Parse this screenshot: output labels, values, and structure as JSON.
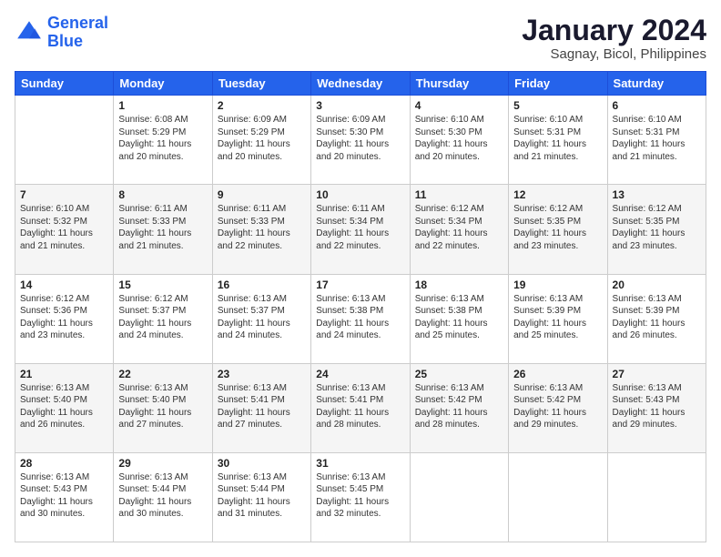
{
  "logo": {
    "line1": "General",
    "line2": "Blue"
  },
  "title": "January 2024",
  "subtitle": "Sagnay, Bicol, Philippines",
  "days_header": [
    "Sunday",
    "Monday",
    "Tuesday",
    "Wednesday",
    "Thursday",
    "Friday",
    "Saturday"
  ],
  "weeks": [
    [
      {
        "num": "",
        "detail": ""
      },
      {
        "num": "1",
        "detail": "Sunrise: 6:08 AM\nSunset: 5:29 PM\nDaylight: 11 hours\nand 20 minutes."
      },
      {
        "num": "2",
        "detail": "Sunrise: 6:09 AM\nSunset: 5:29 PM\nDaylight: 11 hours\nand 20 minutes."
      },
      {
        "num": "3",
        "detail": "Sunrise: 6:09 AM\nSunset: 5:30 PM\nDaylight: 11 hours\nand 20 minutes."
      },
      {
        "num": "4",
        "detail": "Sunrise: 6:10 AM\nSunset: 5:30 PM\nDaylight: 11 hours\nand 20 minutes."
      },
      {
        "num": "5",
        "detail": "Sunrise: 6:10 AM\nSunset: 5:31 PM\nDaylight: 11 hours\nand 21 minutes."
      },
      {
        "num": "6",
        "detail": "Sunrise: 6:10 AM\nSunset: 5:31 PM\nDaylight: 11 hours\nand 21 minutes."
      }
    ],
    [
      {
        "num": "7",
        "detail": "Sunrise: 6:10 AM\nSunset: 5:32 PM\nDaylight: 11 hours\nand 21 minutes."
      },
      {
        "num": "8",
        "detail": "Sunrise: 6:11 AM\nSunset: 5:33 PM\nDaylight: 11 hours\nand 21 minutes."
      },
      {
        "num": "9",
        "detail": "Sunrise: 6:11 AM\nSunset: 5:33 PM\nDaylight: 11 hours\nand 22 minutes."
      },
      {
        "num": "10",
        "detail": "Sunrise: 6:11 AM\nSunset: 5:34 PM\nDaylight: 11 hours\nand 22 minutes."
      },
      {
        "num": "11",
        "detail": "Sunrise: 6:12 AM\nSunset: 5:34 PM\nDaylight: 11 hours\nand 22 minutes."
      },
      {
        "num": "12",
        "detail": "Sunrise: 6:12 AM\nSunset: 5:35 PM\nDaylight: 11 hours\nand 23 minutes."
      },
      {
        "num": "13",
        "detail": "Sunrise: 6:12 AM\nSunset: 5:35 PM\nDaylight: 11 hours\nand 23 minutes."
      }
    ],
    [
      {
        "num": "14",
        "detail": "Sunrise: 6:12 AM\nSunset: 5:36 PM\nDaylight: 11 hours\nand 23 minutes."
      },
      {
        "num": "15",
        "detail": "Sunrise: 6:12 AM\nSunset: 5:37 PM\nDaylight: 11 hours\nand 24 minutes."
      },
      {
        "num": "16",
        "detail": "Sunrise: 6:13 AM\nSunset: 5:37 PM\nDaylight: 11 hours\nand 24 minutes."
      },
      {
        "num": "17",
        "detail": "Sunrise: 6:13 AM\nSunset: 5:38 PM\nDaylight: 11 hours\nand 24 minutes."
      },
      {
        "num": "18",
        "detail": "Sunrise: 6:13 AM\nSunset: 5:38 PM\nDaylight: 11 hours\nand 25 minutes."
      },
      {
        "num": "19",
        "detail": "Sunrise: 6:13 AM\nSunset: 5:39 PM\nDaylight: 11 hours\nand 25 minutes."
      },
      {
        "num": "20",
        "detail": "Sunrise: 6:13 AM\nSunset: 5:39 PM\nDaylight: 11 hours\nand 26 minutes."
      }
    ],
    [
      {
        "num": "21",
        "detail": "Sunrise: 6:13 AM\nSunset: 5:40 PM\nDaylight: 11 hours\nand 26 minutes."
      },
      {
        "num": "22",
        "detail": "Sunrise: 6:13 AM\nSunset: 5:40 PM\nDaylight: 11 hours\nand 27 minutes."
      },
      {
        "num": "23",
        "detail": "Sunrise: 6:13 AM\nSunset: 5:41 PM\nDaylight: 11 hours\nand 27 minutes."
      },
      {
        "num": "24",
        "detail": "Sunrise: 6:13 AM\nSunset: 5:41 PM\nDaylight: 11 hours\nand 28 minutes."
      },
      {
        "num": "25",
        "detail": "Sunrise: 6:13 AM\nSunset: 5:42 PM\nDaylight: 11 hours\nand 28 minutes."
      },
      {
        "num": "26",
        "detail": "Sunrise: 6:13 AM\nSunset: 5:42 PM\nDaylight: 11 hours\nand 29 minutes."
      },
      {
        "num": "27",
        "detail": "Sunrise: 6:13 AM\nSunset: 5:43 PM\nDaylight: 11 hours\nand 29 minutes."
      }
    ],
    [
      {
        "num": "28",
        "detail": "Sunrise: 6:13 AM\nSunset: 5:43 PM\nDaylight: 11 hours\nand 30 minutes."
      },
      {
        "num": "29",
        "detail": "Sunrise: 6:13 AM\nSunset: 5:44 PM\nDaylight: 11 hours\nand 30 minutes."
      },
      {
        "num": "30",
        "detail": "Sunrise: 6:13 AM\nSunset: 5:44 PM\nDaylight: 11 hours\nand 31 minutes."
      },
      {
        "num": "31",
        "detail": "Sunrise: 6:13 AM\nSunset: 5:45 PM\nDaylight: 11 hours\nand 32 minutes."
      },
      {
        "num": "",
        "detail": ""
      },
      {
        "num": "",
        "detail": ""
      },
      {
        "num": "",
        "detail": ""
      }
    ]
  ]
}
